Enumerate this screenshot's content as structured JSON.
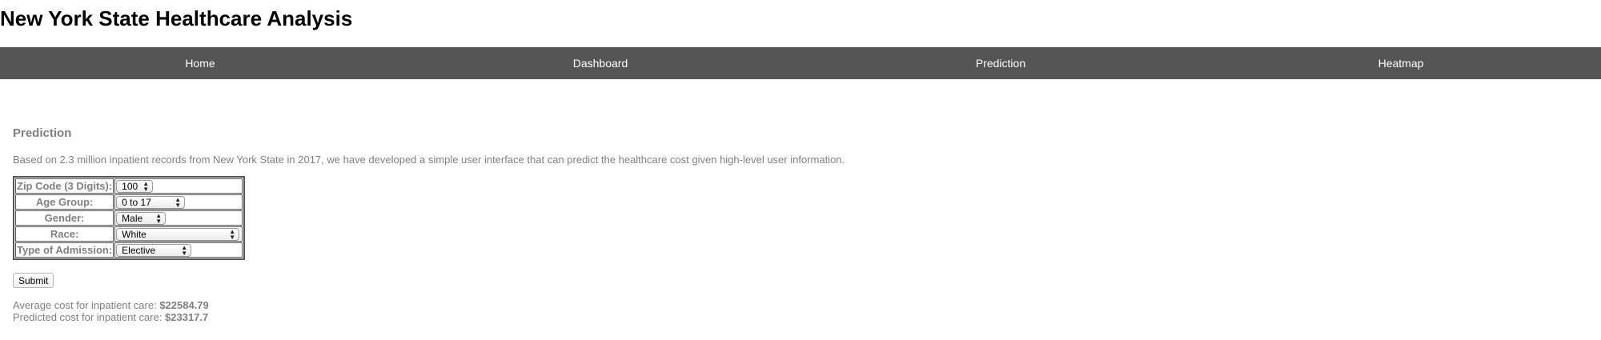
{
  "header": {
    "title": "New York State Healthcare Analysis"
  },
  "nav": {
    "items": [
      {
        "label": "Home"
      },
      {
        "label": "Dashboard"
      },
      {
        "label": "Prediction"
      },
      {
        "label": "Heatmap"
      }
    ]
  },
  "colors": {
    "nav_background": "#555555",
    "muted_text": "#808080"
  },
  "main": {
    "title": "Prediction",
    "description": "Based on 2.3 million inpatient records from New York State in 2017, we have developed a simple user interface that can predict the healthcare cost given high-level user information.",
    "form": {
      "fields": [
        {
          "label": "Zip Code (3 Digits):",
          "value": "100"
        },
        {
          "label": "Age Group:",
          "value": "0 to 17"
        },
        {
          "label": "Gender:",
          "value": "Male"
        },
        {
          "label": "Race:",
          "value": "White"
        },
        {
          "label": "Type of Admission:",
          "value": "Elective"
        }
      ],
      "submit_label": "Submit"
    },
    "results": {
      "average_label": "Average cost for inpatient care: ",
      "average_value": "$22584.79",
      "predicted_label": "Predicted cost for inpatient care: ",
      "predicted_value": "$23317.7"
    }
  }
}
